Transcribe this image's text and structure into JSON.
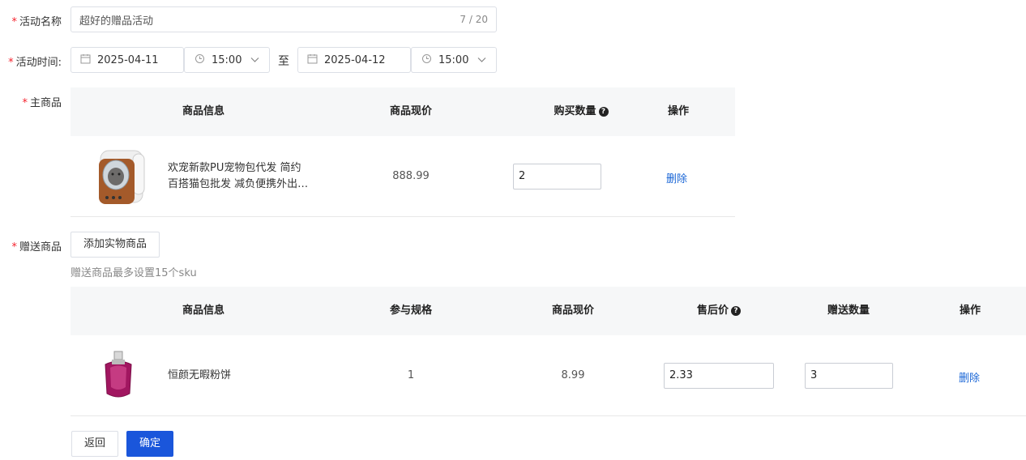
{
  "form": {
    "name_label": "活动名称",
    "name_value": "超好的赠品活动",
    "name_count": "7 / 20",
    "time_label": "活动时间:",
    "start_date": "2025-04-11",
    "start_time": "15:00",
    "separator": "至",
    "end_date": "2025-04-12",
    "end_time": "15:00",
    "main_label": "主商品",
    "gift_label": "赠送商品"
  },
  "main_table": {
    "headers": [
      "商品信息",
      "商品现价",
      "购买数量",
      "操作"
    ],
    "row": {
      "title_line1": "欢宠新款PU宠物包代发 简约",
      "title_line2": "百搭猫包批发 减负便携外出…",
      "price": "888.99",
      "quantity": "2",
      "action": "删除"
    }
  },
  "gift": {
    "add_button": "添加实物商品",
    "hint": "赠送商品最多设置15个sku"
  },
  "gift_table": {
    "headers": [
      "商品信息",
      "参与规格",
      "商品现价",
      "售后价",
      "赠送数量",
      "操作"
    ],
    "row": {
      "title": "恒颜无暇粉饼",
      "spec": "1",
      "price": "8.99",
      "after_sale_price": "2.33",
      "gift_quantity": "3",
      "action": "删除"
    }
  },
  "footer": {
    "back_label": "返回",
    "confirm_label": "确定"
  },
  "icons": {
    "calendar": "calendar-icon",
    "clock": "clock-icon",
    "chevron": "chevron-down-icon",
    "help": "question-circle-icon"
  },
  "colors": {
    "required": "#f5222d",
    "link": "#1a66d6",
    "primary": "#1a56db",
    "table_header": "#f6f7f8"
  }
}
